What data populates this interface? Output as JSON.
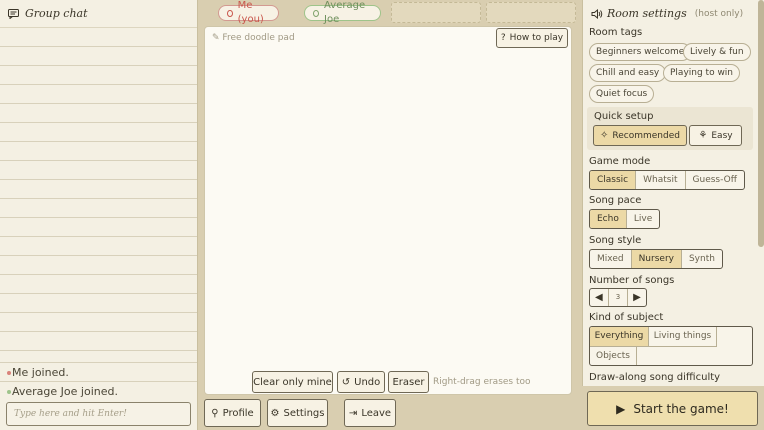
{
  "chat": {
    "title": "Group chat",
    "messages": [
      {
        "name": "Me",
        "text": " joined.",
        "color": "#d9827a"
      },
      {
        "name": "Average Joe",
        "text": " joined.",
        "color": "#9ec48a"
      }
    ],
    "input_placeholder": "Type here and hit Enter!"
  },
  "players": [
    {
      "label": "Me (you)",
      "color": "#c9574c"
    },
    {
      "label": "Average Joe",
      "color": "#7fa36b"
    }
  ],
  "pad": {
    "label": "Free doodle pad",
    "how_to_play": "How to play",
    "clear_mine": "Clear only mine",
    "undo": "Undo",
    "eraser": "Eraser",
    "hint": "Right-drag erases too"
  },
  "bottom": {
    "profile": "Profile",
    "settings": "Settings",
    "leave": "Leave"
  },
  "settings": {
    "title": "Room settings",
    "subtitle": "(host only)",
    "room_tags_label": "Room tags",
    "room_tags": [
      "Beginners welcome",
      "Lively & fun",
      "Chill and easy",
      "Playing to win",
      "Quiet focus"
    ],
    "quick_setup_label": "Quick setup",
    "recommended": "Recommended",
    "easy": "Easy",
    "game_mode_label": "Game mode",
    "game_modes": [
      "Classic",
      "Whatsit",
      "Guess-Off"
    ],
    "song_pace_label": "Song pace",
    "song_paces": [
      "Echo",
      "Live"
    ],
    "song_style_label": "Song style",
    "song_styles": [
      "Mixed",
      "Nursery",
      "Synth"
    ],
    "songs_label": "Number of songs",
    "songs_value": "3",
    "subject_label": "Kind of subject",
    "subjects": [
      "Everything",
      "Living things",
      "Objects"
    ],
    "difficulty_label": "Draw-along song difficulty"
  },
  "start_label": "Start the game!"
}
